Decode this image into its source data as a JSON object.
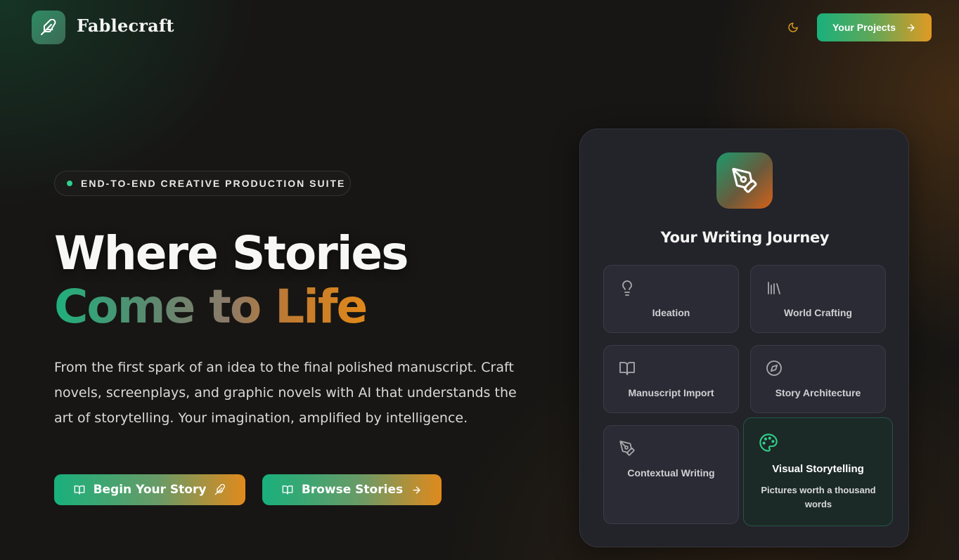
{
  "header": {
    "brand": "Fablecraft",
    "logo_icon": "feather-icon",
    "theme_icon": "moon-icon",
    "projects_label": "Your Projects",
    "projects_icon": "arrow-right-icon"
  },
  "hero": {
    "badge": "END-TO-END CREATIVE PRODUCTION SUITE",
    "title_line1": "Where Stories",
    "title_line2": "Come to Life",
    "description": "From the first spark of an idea to the final polished manuscript. Craft novels, screenplays, and graphic novels with AI that understands the art of storytelling. Your imagination, amplified by intelligence.",
    "cta_primary": "Begin Your Story",
    "cta_secondary": "Browse Stories"
  },
  "journey": {
    "title": "Your Writing Journey",
    "icon": "pen-tool-icon",
    "steps": [
      {
        "label": "Ideation",
        "icon": "lightbulb-icon"
      },
      {
        "label": "World Crafting",
        "icon": "library-icon"
      },
      {
        "label": "Manuscript Import",
        "icon": "book-open-icon"
      },
      {
        "label": "Story Architecture",
        "icon": "compass-icon"
      },
      {
        "label": "Contextual Writing",
        "icon": "pen-tool-icon"
      },
      {
        "label": "Visual Storytelling",
        "icon": "palette-icon",
        "subtitle": "Pictures worth a thousand words",
        "active": true
      }
    ]
  },
  "colors": {
    "accent_green": "#19b07c",
    "accent_orange": "#e0881a",
    "background": "#171614",
    "card": "#23232a"
  }
}
